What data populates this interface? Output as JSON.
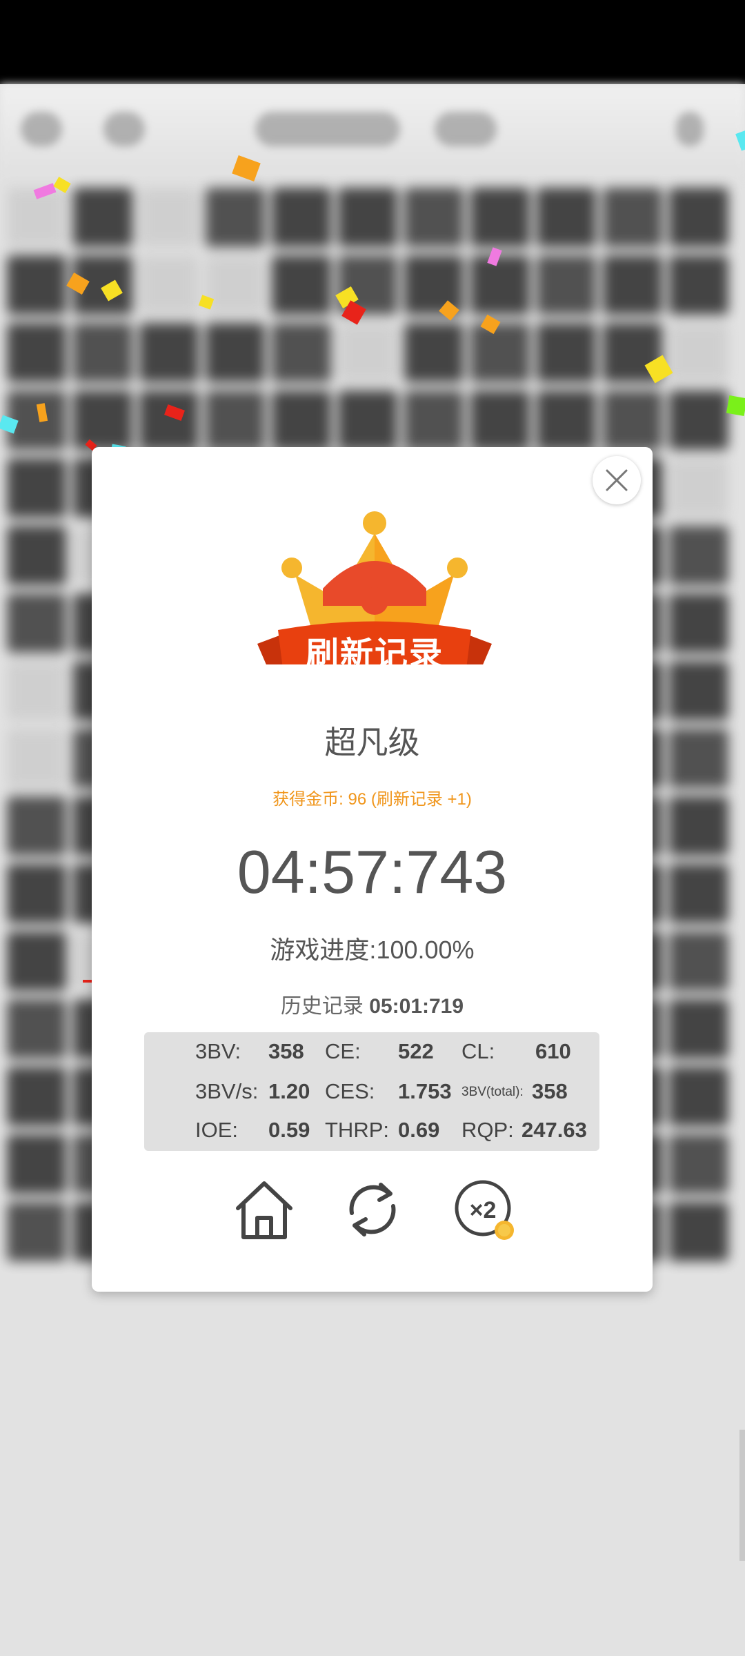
{
  "dialog": {
    "banner": "刷新记录",
    "level": "超凡级",
    "reward": "获得金币: 96 (刷新记录 +1)",
    "time": "04:57:743",
    "progress_label": "游戏进度:",
    "progress_value": "100.00%",
    "history_label": "历史记录",
    "history_value": "05:01:719"
  },
  "stats": {
    "row1": {
      "l1": "3BV:",
      "v1": "358",
      "l2": "CE:",
      "v2": "522",
      "l3": "CL:",
      "v3": "610"
    },
    "row2": {
      "l1": "3BV/s:",
      "v1": "1.20",
      "l2": "CES:",
      "v2": "1.753",
      "l3": "3BV(total):",
      "v3": "358"
    },
    "row3": {
      "l1": "IOE:",
      "v1": "0.59",
      "l2": "THRP:",
      "v2": "0.69",
      "l3": "RQP:",
      "v3": "247.63"
    }
  },
  "icons": {
    "close": "close-icon",
    "home": "home-icon",
    "restart": "refresh-icon",
    "double": "x2-icon"
  },
  "double_label": "×2",
  "colors": {
    "reward": "#f0961c",
    "crown_gold": "#f5b62e",
    "ribbon_red": "#e8400f"
  }
}
